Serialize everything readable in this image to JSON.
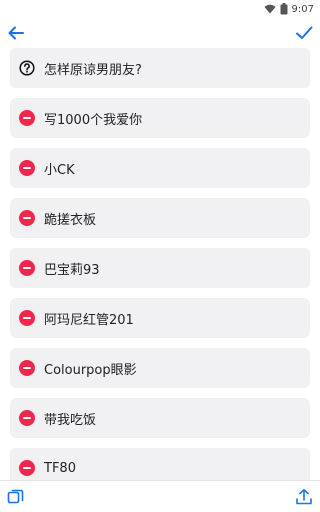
{
  "status_bar": {
    "time": "9:07"
  },
  "colors": {
    "accent": "#1a73e8",
    "remove": "#f0274c",
    "item_bg": "#f1f1f3"
  },
  "icons": {
    "back": "arrow-left-icon",
    "done": "checkmark-icon",
    "question": "question-circle-icon",
    "remove": "minus-circle-icon",
    "copy": "copy-icon",
    "share": "share-icon"
  },
  "list": {
    "items": [
      {
        "label": "怎样原谅男朋友?",
        "icon": "question-circle-icon"
      },
      {
        "label": "写1000个我爱你",
        "icon": "minus-circle-icon"
      },
      {
        "label": "小CK",
        "icon": "minus-circle-icon"
      },
      {
        "label": "跪搓衣板",
        "icon": "minus-circle-icon"
      },
      {
        "label": "巴宝莉93",
        "icon": "minus-circle-icon"
      },
      {
        "label": "阿玛尼红管201",
        "icon": "minus-circle-icon"
      },
      {
        "label": "Colourpop眼影",
        "icon": "minus-circle-icon"
      },
      {
        "label": "带我吃饭",
        "icon": "minus-circle-icon"
      },
      {
        "label": "TF80",
        "icon": "minus-circle-icon"
      }
    ]
  }
}
